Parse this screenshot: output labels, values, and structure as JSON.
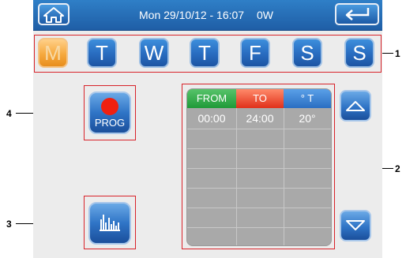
{
  "status_bar": {
    "datetime": "Mon 29/10/12 - 16:07",
    "power": "0W"
  },
  "days": [
    {
      "label": "M",
      "active": true
    },
    {
      "label": "T",
      "active": false
    },
    {
      "label": "W",
      "active": false
    },
    {
      "label": "T",
      "active": false
    },
    {
      "label": "F",
      "active": false
    },
    {
      "label": "S",
      "active": false
    },
    {
      "label": "S",
      "active": false
    }
  ],
  "prog_button": {
    "label": "PROG"
  },
  "table": {
    "headers": {
      "from": "FROM",
      "to": "TO",
      "temp": "° T"
    },
    "rows": [
      {
        "from": "00:00",
        "to": "24:00",
        "temp": "20°"
      }
    ]
  },
  "callouts": {
    "days": "1",
    "table": "2",
    "graph": "3",
    "prog": "4"
  },
  "colors": {
    "header_blue": "#1f5ea6",
    "active_day": "#f6a93e",
    "from_green": "#1f9a38",
    "to_red": "#e0301a",
    "callout_red": "#d8232a"
  }
}
